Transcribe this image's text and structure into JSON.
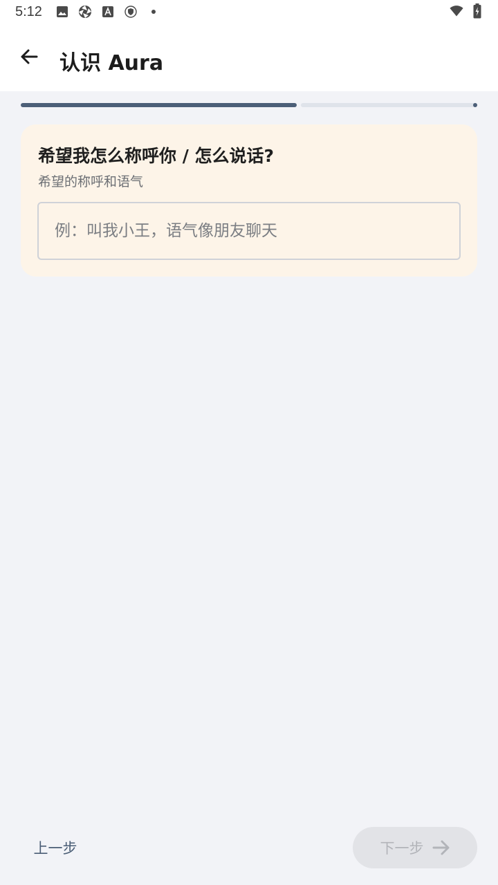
{
  "status_bar": {
    "time": "5:12",
    "icons": [
      "image-icon",
      "aperture-icon",
      "font-a-icon",
      "shield-icon",
      "dot-icon"
    ],
    "right_icons": [
      "wifi-icon",
      "battery-charging-icon"
    ]
  },
  "app_bar": {
    "back_icon": "arrow-left-icon",
    "title": "认识 Aura"
  },
  "progress": {
    "fraction": 0.605
  },
  "card": {
    "title": "希望我怎么称呼你 / 怎么说话?",
    "subtitle": "希望的称呼和语气",
    "input": {
      "value": "",
      "placeholder": "例：叫我小王，语气像朋友聊天"
    }
  },
  "nav": {
    "prev_label": "上一步",
    "next_label": "下一步",
    "next_icon": "arrow-right-icon"
  },
  "colors": {
    "accent": "#4c5f78",
    "card_bg": "#fdf4e8",
    "page_bg": "#f2f3f7",
    "disabled_button_bg": "#e2e3e7"
  }
}
